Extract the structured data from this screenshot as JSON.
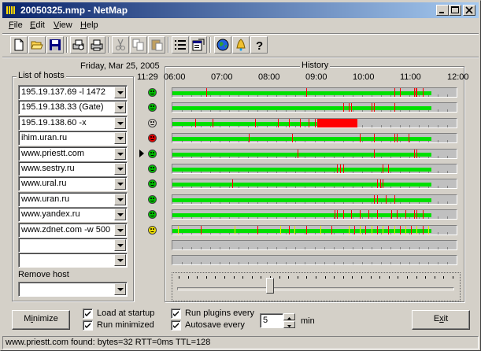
{
  "window": {
    "title": "20050325.nmp - NetMap",
    "minimize_glyph": "0",
    "maximize_glyph": "1",
    "close_glyph": "r"
  },
  "menu": [
    {
      "label": "File",
      "accel": "F",
      "rest": "ile"
    },
    {
      "label": "Edit",
      "accel": "E",
      "rest": "dit"
    },
    {
      "label": "View",
      "accel": "V",
      "rest": "iew"
    },
    {
      "label": "Help",
      "accel": "H",
      "rest": "elp"
    }
  ],
  "toolbar": [
    {
      "icon": "new-document-icon"
    },
    {
      "icon": "open-folder-icon"
    },
    {
      "icon": "save-disk-icon"
    },
    {
      "icon": "print-preview-icon"
    },
    {
      "icon": "print-icon"
    },
    {
      "icon": "cut-icon"
    },
    {
      "icon": "copy-icon"
    },
    {
      "icon": "paste-icon"
    },
    {
      "icon": "list-icon"
    },
    {
      "icon": "properties-icon"
    },
    {
      "icon": "globe-icon"
    },
    {
      "icon": "bell-icon"
    },
    {
      "icon": "help-icon"
    }
  ],
  "date_label": "Friday, Mar 25, 2005",
  "current_time": "11:29",
  "hosts_group_label": "List of hosts",
  "history_group_label": "History",
  "time_axis": [
    "06:00",
    "07:00",
    "08:00",
    "09:00",
    "10:00",
    "11:00",
    "12:00"
  ],
  "hosts": [
    {
      "name": "195.19.137.69 -l 1472",
      "status": "ok",
      "color": "#00c000",
      "selected": false,
      "green_end": 0.91,
      "marks": [
        0.12,
        0.47,
        0.78,
        0.8,
        0.85,
        0.855,
        0.86,
        0.88
      ],
      "blocks": []
    },
    {
      "name": "195.19.138.33 (Gate)",
      "status": "ok",
      "color": "#00c000",
      "selected": false,
      "green_end": 0.91,
      "marks": [
        0.6,
        0.62,
        0.63,
        0.7,
        0.71,
        0.78
      ],
      "blocks": []
    },
    {
      "name": "195.19.138.60 -x",
      "status": "ok",
      "color": "#d4d0c8",
      "selected": false,
      "green_end": 0.51,
      "marks": [
        0.08,
        0.14,
        0.29,
        0.37,
        0.41,
        0.45,
        0.48,
        0.5
      ],
      "blocks": [
        [
          0.51,
          0.65
        ]
      ]
    },
    {
      "name": "ihim.uran.ru",
      "status": "down",
      "color": "#e00000",
      "selected": false,
      "green_end": 0.91,
      "marks": [
        0.27,
        0.42,
        0.66,
        0.71,
        0.78,
        0.79,
        0.83
      ],
      "blocks": []
    },
    {
      "name": "www.priestt.com",
      "status": "ok",
      "color": "#00c000",
      "selected": true,
      "green_end": 0.91,
      "marks": [
        0.44,
        0.71,
        0.85,
        0.86
      ],
      "blocks": []
    },
    {
      "name": "www.sestry.ru",
      "status": "ok",
      "color": "#00c000",
      "selected": false,
      "green_end": 0.91,
      "marks": [
        0.58,
        0.59,
        0.6,
        0.74,
        0.76
      ],
      "blocks": []
    },
    {
      "name": "www.ural.ru",
      "status": "ok",
      "color": "#00c000",
      "selected": false,
      "green_end": 0.91,
      "marks": [
        0.21,
        0.72,
        0.73,
        0.74
      ],
      "blocks": []
    },
    {
      "name": "www.uran.ru",
      "status": "ok",
      "color": "#00c000",
      "selected": false,
      "green_end": 0.91,
      "marks": [
        0.71,
        0.72,
        0.75,
        0.78
      ],
      "blocks": []
    },
    {
      "name": "www.yandex.ru",
      "status": "ok",
      "color": "#00c000",
      "selected": false,
      "green_end": 0.91,
      "marks": [
        0.57,
        0.58,
        0.6,
        0.63,
        0.66,
        0.69,
        0.72,
        0.77,
        0.79,
        0.82,
        0.85,
        0.86,
        0.88
      ],
      "blocks": []
    },
    {
      "name": "www.zdnet.com -w 500",
      "status": "warn",
      "color": "#f0e000",
      "selected": false,
      "green_end": 0.91,
      "marks": [
        0.02,
        0.1,
        0.22,
        0.3,
        0.38,
        0.41,
        0.43,
        0.47,
        0.52,
        0.56,
        0.62,
        0.64,
        0.66,
        0.68,
        0.7,
        0.72,
        0.74,
        0.76,
        0.78,
        0.8,
        0.82,
        0.84,
        0.86,
        0.88,
        0.9
      ],
      "blocks": []
    },
    {
      "name": "",
      "status": "none",
      "color": "",
      "selected": false,
      "green_end": 0,
      "marks": [],
      "blocks": []
    },
    {
      "name": "",
      "status": "none",
      "color": "",
      "selected": false,
      "green_end": 0,
      "marks": [],
      "blocks": []
    }
  ],
  "remove_host_label": "Remove host",
  "remove_host_value": "",
  "buttons": {
    "minimize": {
      "accel": "i",
      "pre": "M",
      "post": "nimize"
    },
    "exit": {
      "accel": "x",
      "pre": "E",
      "post": "it"
    }
  },
  "options": {
    "load_at_startup": {
      "label": "Load at startup",
      "checked": true
    },
    "run_minimized": {
      "label": "Run minimized",
      "checked": true
    },
    "run_plugins_every": {
      "label": "Run plugins every",
      "checked": true
    },
    "autosave_every": {
      "label": "Autosave every",
      "checked": true
    }
  },
  "interval": {
    "value": "5",
    "unit": "min"
  },
  "status_bar": "www.priestt.com found: bytes=32 RTT=0ms TTL=128",
  "slider_position": 0.34
}
